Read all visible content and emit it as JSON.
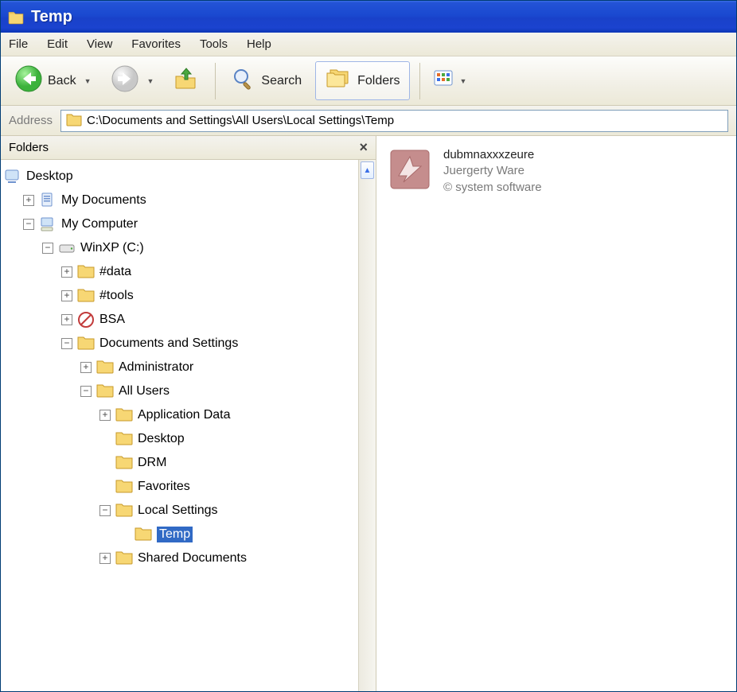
{
  "window": {
    "title": "Temp"
  },
  "menu": {
    "file": "File",
    "edit": "Edit",
    "view": "View",
    "favorites": "Favorites",
    "tools": "Tools",
    "help": "Help"
  },
  "toolbar": {
    "back": "Back",
    "search": "Search",
    "folders": "Folders"
  },
  "address": {
    "label": "Address",
    "path": "C:\\Documents and Settings\\All Users\\Local Settings\\Temp"
  },
  "folders_pane": {
    "title": "Folders"
  },
  "tree": {
    "desktop": "Desktop",
    "my_documents": "My Documents",
    "my_computer": "My Computer",
    "winxp": "WinXP (C:)",
    "data": "#data",
    "tools": "#tools",
    "bsa": "BSA",
    "docs_settings": "Documents and Settings",
    "administrator": "Administrator",
    "all_users": "All Users",
    "app_data": "Application Data",
    "desktop2": "Desktop",
    "drm": "DRM",
    "favorites": "Favorites",
    "local_settings": "Local Settings",
    "temp": "Temp",
    "shared_docs": "Shared Documents"
  },
  "file": {
    "name": "dubmnaxxxzeure",
    "company": "Juergerty Ware",
    "copyright": "© system software"
  }
}
